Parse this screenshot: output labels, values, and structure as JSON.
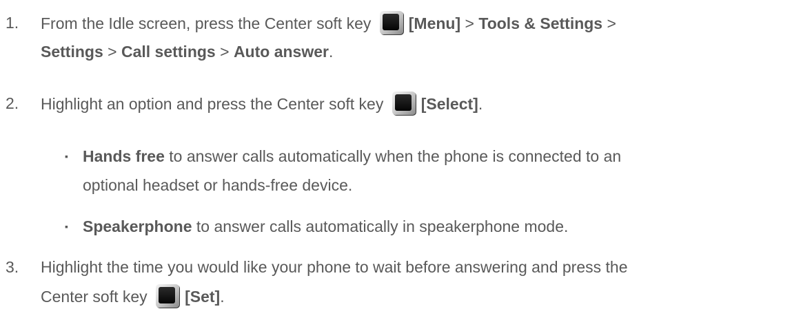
{
  "steps": [
    {
      "number": "1.",
      "line1": {
        "pre": "From the Idle screen, press the Center soft key ",
        "b1": "[Menu]",
        "s1": " > ",
        "b2": "Tools & Settings",
        "s2": " >"
      },
      "line2": {
        "b1": "Settings",
        "s1": " > ",
        "b2": "Call settings",
        "s2": " > ",
        "b3": "Auto answer",
        "post": "."
      }
    },
    {
      "number": "2.",
      "pre": "Highlight an option and press the Center soft key ",
      "bold": "[Select]",
      "post": "."
    },
    {
      "number": "3.",
      "line1": "Highlight the time you would like your phone to wait before answering and press the",
      "line2": {
        "pre": "Center soft key ",
        "bold": "[Set]",
        "post": "."
      }
    }
  ],
  "bullets": [
    {
      "mark": "▪",
      "bold": "Hands free",
      "text1": " to answer calls automatically when the phone is connected to an",
      "text2": "optional headset or hands-free device."
    },
    {
      "mark": "▪",
      "bold": "Speakerphone",
      "text1": " to answer calls automatically in speakerphone mode."
    }
  ],
  "icons": {
    "soft_key": "center-soft-key-icon"
  }
}
